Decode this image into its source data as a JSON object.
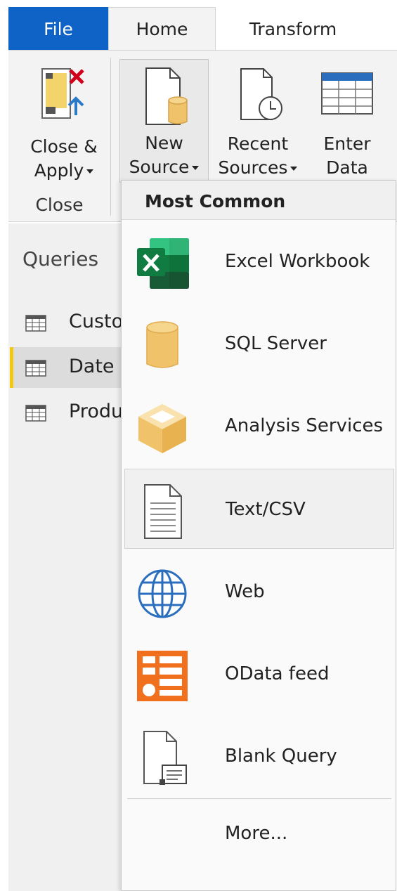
{
  "tabs": {
    "file": "File",
    "home": "Home",
    "transform": "Transform"
  },
  "ribbon": {
    "close_apply": {
      "line1": "Close &",
      "line2": "Apply"
    },
    "new_source": {
      "line1": "New",
      "line2": "Source"
    },
    "recent_sources": {
      "line1": "Recent",
      "line2": "Sources"
    },
    "enter_data": {
      "line1": "Enter",
      "line2": "Data"
    },
    "group_close": "Close"
  },
  "queries": {
    "title": "Queries",
    "items": [
      {
        "label": "Customer"
      },
      {
        "label": "Date",
        "selected": true
      },
      {
        "label": "Product"
      }
    ]
  },
  "menu": {
    "header": "Most Common",
    "items": [
      {
        "label": "Excel Workbook",
        "icon": "excel-icon"
      },
      {
        "label": "SQL Server",
        "icon": "database-icon"
      },
      {
        "label": "Analysis Services",
        "icon": "cube-icon"
      },
      {
        "label": "Text/CSV",
        "icon": "text-file-icon",
        "hovered": true
      },
      {
        "label": "Web",
        "icon": "globe-icon"
      },
      {
        "label": "OData feed",
        "icon": "odata-icon"
      },
      {
        "label": "Blank Query",
        "icon": "blank-query-icon"
      }
    ],
    "more": "More..."
  },
  "colors": {
    "file_tab": "#0f62c6",
    "accent_yellow": "#f2c811",
    "excel_green": "#1d7044",
    "odata_orange": "#f0701e",
    "db_gold": "#f0c36a"
  }
}
